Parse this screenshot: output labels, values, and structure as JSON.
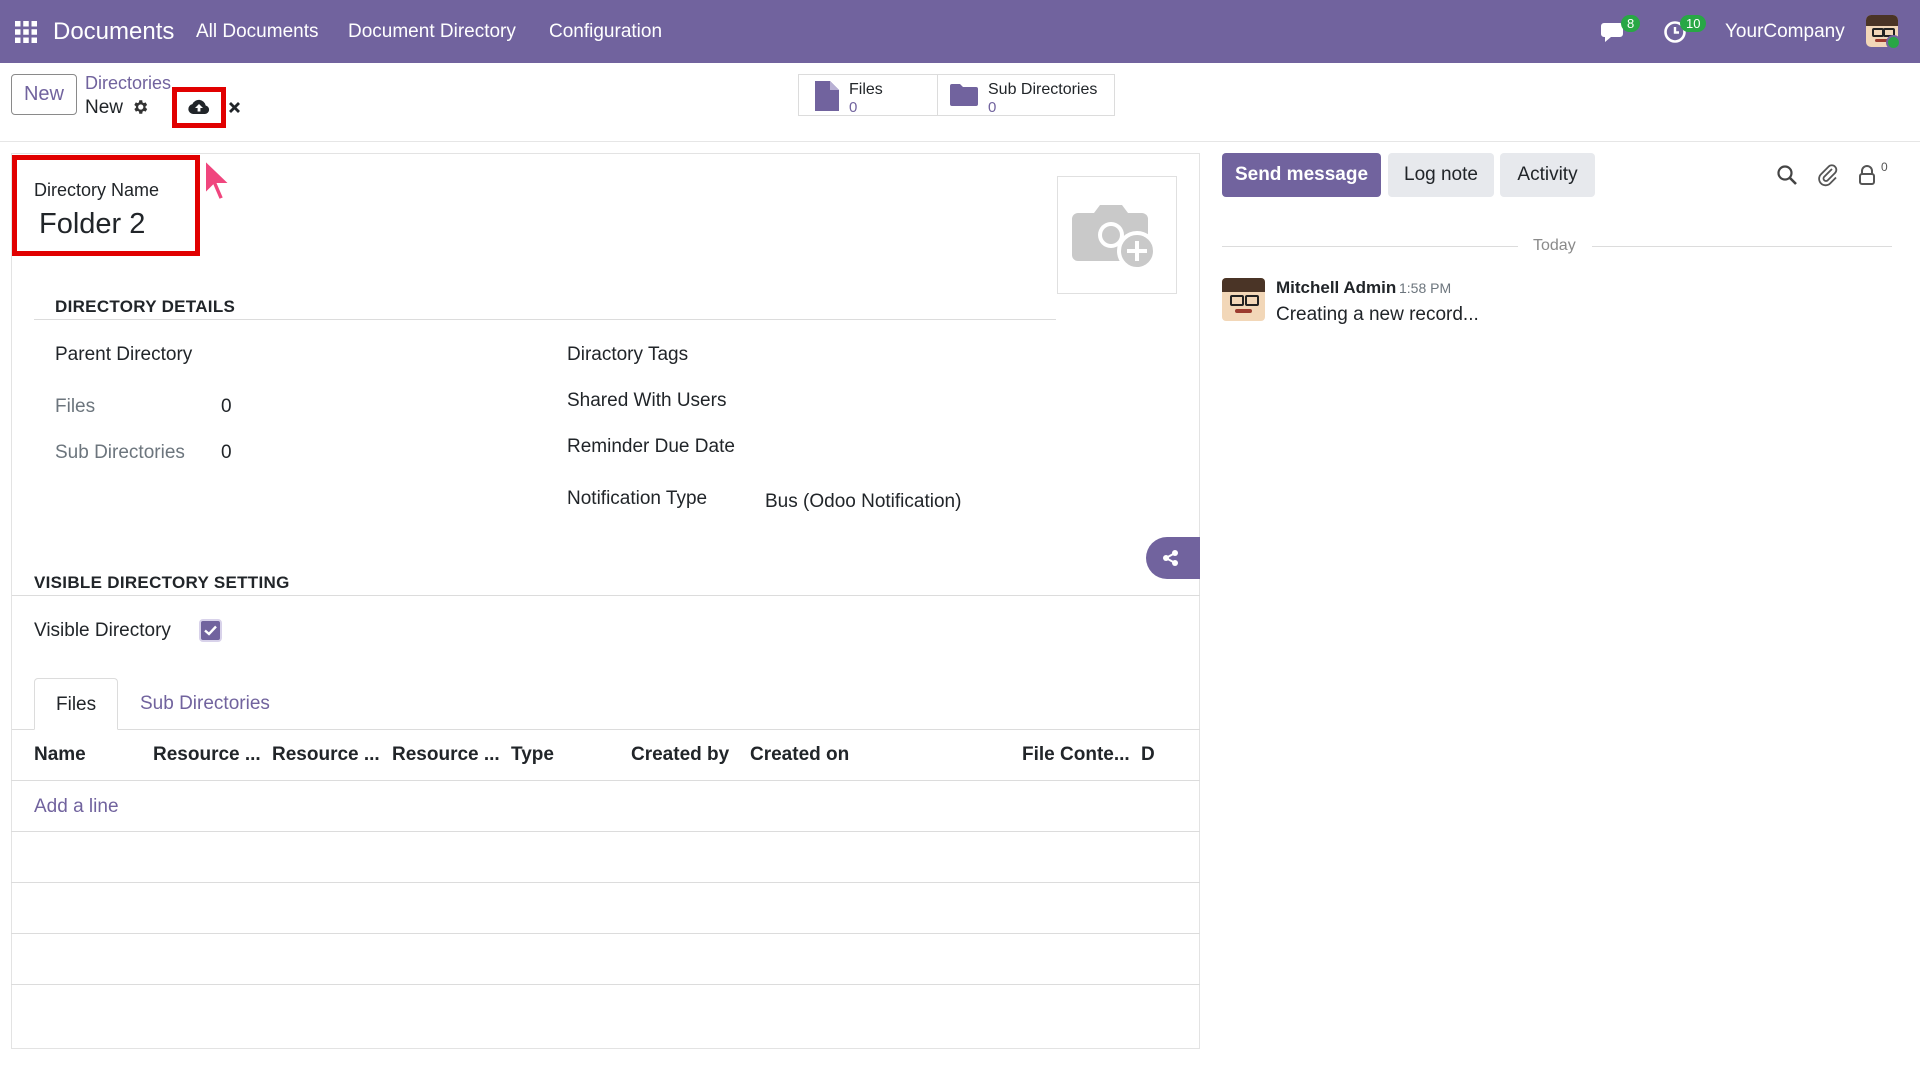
{
  "navbar": {
    "app_name": "Documents",
    "menu": [
      "All Documents",
      "Document Directory",
      "Configuration"
    ],
    "messages_count": "8",
    "activities_count": "10",
    "company": "YourCompany",
    "color": "#71639e"
  },
  "control_panel": {
    "new_button": "New",
    "breadcrumb_parent": "Directories",
    "breadcrumb_current": "New",
    "smart_buttons": [
      {
        "label": "Files",
        "value": "0",
        "icon": "file-icon"
      },
      {
        "label": "Sub Directories",
        "value": "0",
        "icon": "folder-icon"
      }
    ]
  },
  "form": {
    "directory_name_label": "Directory Name",
    "directory_name_value": "Folder 2",
    "directory_details_title": "DIRECTORY DETAILS",
    "parent_directory_label": "Parent Directory",
    "files_label": "Files",
    "files_value": "0",
    "sub_directories_label": "Sub Directories",
    "sub_directories_value": "0",
    "directory_tags_label": "Diractory Tags",
    "shared_with_users_label": "Shared With Users",
    "reminder_due_date_label": "Reminder Due Date",
    "notification_type_label": "Notification Type",
    "notification_type_value": "Bus (Odoo Notification)",
    "visible_setting_title": "VISIBLE DIRECTORY SETTING",
    "visible_directory_label": "Visible Directory",
    "visible_directory_checked": true,
    "tabs": [
      "Files",
      "Sub Directories"
    ],
    "table_columns": [
      "Name",
      "Resource ...",
      "Resource ...",
      "Resource ...",
      "Type",
      "Created by",
      "Created on",
      "File Conte...",
      "D"
    ],
    "add_line": "Add a line"
  },
  "chatter": {
    "send_message": "Send message",
    "log_note": "Log note",
    "activity": "Activity",
    "followers_count": "0",
    "date_separator": "Today",
    "messages": [
      {
        "author": "Mitchell Admin",
        "time": "1:58 PM",
        "body": "Creating a new record..."
      }
    ]
  }
}
